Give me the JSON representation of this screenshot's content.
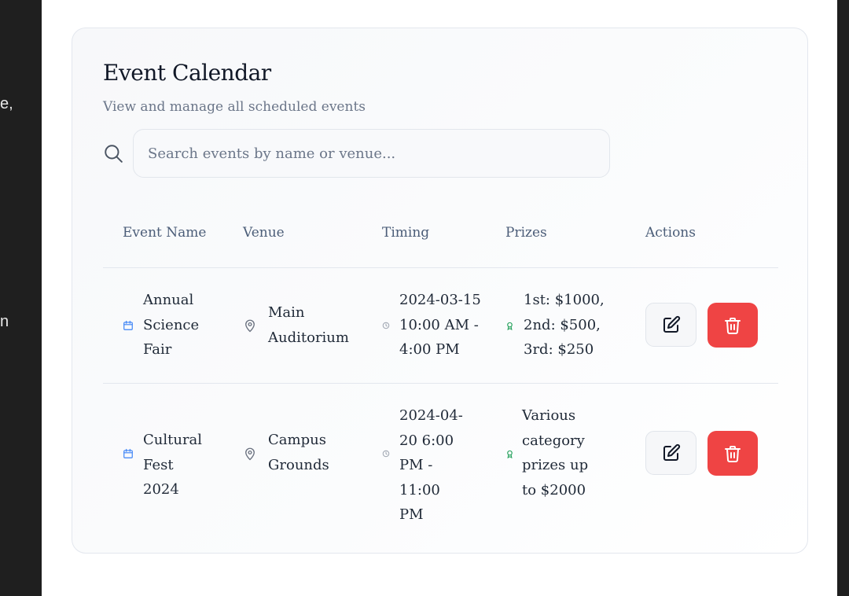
{
  "background_fragments": {
    "frag1": "e,",
    "frag2": "n"
  },
  "card": {
    "title": "Event Calendar",
    "subtitle": "View and manage all scheduled events",
    "search": {
      "placeholder": "Search events by name or venue...",
      "value": ""
    }
  },
  "table": {
    "headers": {
      "name": "Event Name",
      "venue": "Venue",
      "timing": "Timing",
      "prizes": "Prizes",
      "actions": "Actions"
    },
    "rows": [
      {
        "name": "Annual Science Fair",
        "venue": "Main Auditorium",
        "timing": "2024-03-15 10:00 AM - 4:00 PM",
        "prizes": "1st: $1000, 2nd: $500, 3rd: $250"
      },
      {
        "name": "Cultural Fest 2024",
        "venue": "Campus Grounds",
        "timing": "2024-04-20 6:00 PM - 11:00 PM",
        "prizes": "Various category prizes up to $2000"
      }
    ]
  },
  "icons": {
    "search": "search-icon",
    "calendar": "calendar-icon",
    "location": "map-pin-icon",
    "clock": "clock-icon",
    "award": "award-icon",
    "edit": "edit-icon",
    "delete": "trash-icon"
  },
  "colors": {
    "delete": "#ef4444",
    "calendar_icon": "#3b82f6",
    "award_icon": "#22a05a",
    "text": "#1f2937",
    "muted": "#6b7689"
  }
}
